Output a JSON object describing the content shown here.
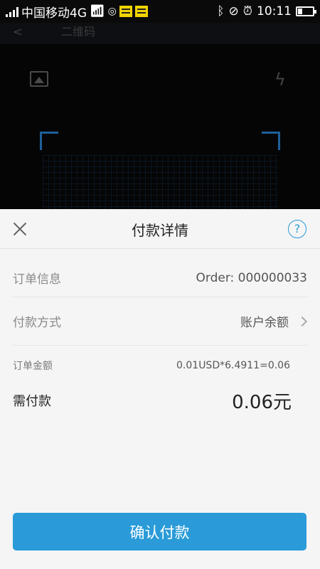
{
  "status_bar": {
    "carrier": "中国移动4G",
    "time": "10:11",
    "icons": [
      "signal-icon",
      "wifi-icon",
      "weibo-icon",
      "notification-icon",
      "bluetooth-icon",
      "mute-icon",
      "alarm-icon",
      "battery-icon"
    ],
    "battery_level": 0.25
  },
  "scanner": {
    "title": "二维码",
    "icons": [
      "back-icon",
      "album-icon",
      "flash-icon"
    ],
    "frame_color": "#1e5f99"
  },
  "sheet": {
    "title": "付款详情",
    "help_label": "?",
    "order_label": "订单信息",
    "order_value": "Order: 000000033",
    "method_label": "付款方式",
    "method_value": "账户余额",
    "amount_label": "订单金额",
    "amount_value": "0.01USD*6.4911=0.06",
    "need_label": "需付款",
    "need_value": "0.06元",
    "confirm_label": "确认付款",
    "accent_color": "#2a9bd8"
  }
}
